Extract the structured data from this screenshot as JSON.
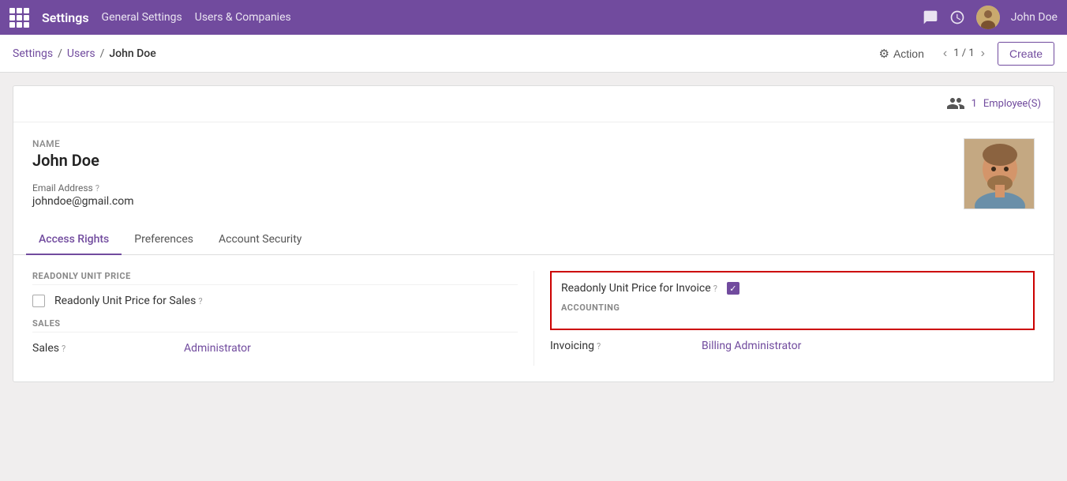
{
  "app": {
    "name": "Settings",
    "nav_links": [
      "General Settings",
      "Users & Companies"
    ]
  },
  "top_nav_icons": {
    "message_icon": "💬",
    "clock_icon": "🕐"
  },
  "user": {
    "name": "John Doe",
    "email": "johndoe@gmail.com",
    "nav_label": "John Doe"
  },
  "breadcrumb": {
    "parts": [
      "Settings",
      "Users",
      "John Doe"
    ],
    "links": [
      "Settings",
      "Users"
    ],
    "current": "John Doe"
  },
  "toolbar": {
    "action_label": "Action",
    "pager": "1 / 1",
    "create_label": "Create"
  },
  "employee_section": {
    "count": "1",
    "label": "Employee(S)"
  },
  "form": {
    "name_label": "Name",
    "name_value": "John Doe",
    "email_label": "Email Address",
    "email_value": "johndoe@gmail.com"
  },
  "tabs": [
    {
      "id": "access-rights",
      "label": "Access Rights",
      "active": true
    },
    {
      "id": "preferences",
      "label": "Preferences",
      "active": false
    },
    {
      "id": "account-security",
      "label": "Account Security",
      "active": false
    }
  ],
  "access_rights": {
    "left_section_header": "READONLY UNIT PRICE",
    "left_fields": [
      {
        "label": "Readonly Unit Price for Sales",
        "has_help": true,
        "checked": false
      }
    ],
    "right_highlighted": {
      "fields": [
        {
          "label": "Readonly Unit Price for Invoice",
          "has_help": true,
          "checked": true
        }
      ],
      "section_header": "ACCOUNTING"
    },
    "sales_section": {
      "header": "SALES",
      "field_label": "Sales",
      "has_help": true,
      "field_value": "Administrator"
    },
    "invoicing_section": {
      "field_label": "Invoicing",
      "has_help": true,
      "field_value": "Billing Administrator"
    }
  }
}
